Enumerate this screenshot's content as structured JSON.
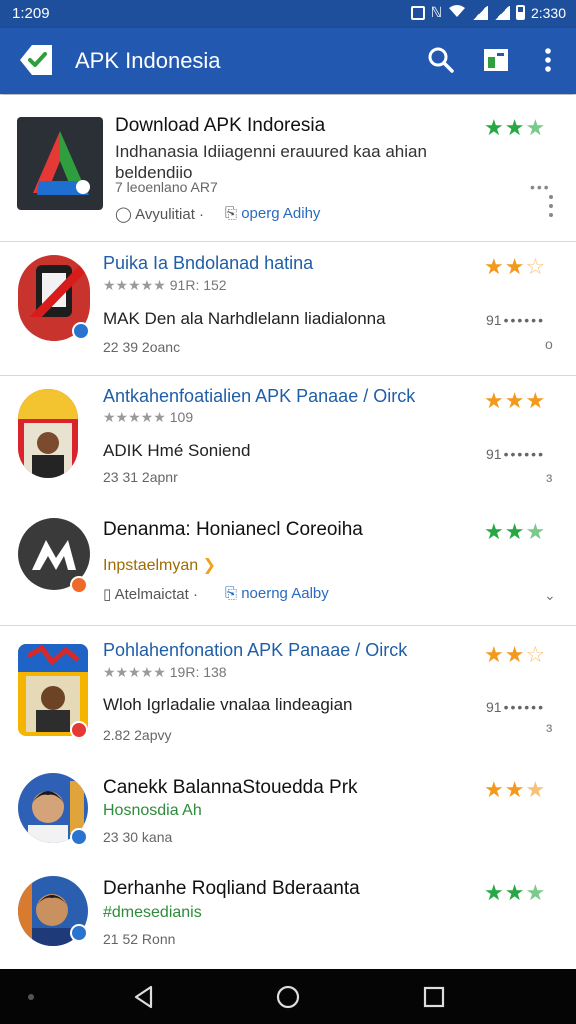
{
  "status_bar": {
    "time": "1:209",
    "right_text": "2:330",
    "icons": [
      "gallery-icon",
      "nfc-icon",
      "wifi-icon",
      "signal-icon",
      "signal-icon",
      "battery-icon"
    ]
  },
  "app_bar": {
    "title": "APK Indonesia",
    "actions": [
      "search-icon",
      "bookmark-icon",
      "more-vert-icon"
    ]
  },
  "colors": {
    "appbar": "#2258b0",
    "statusbar": "#1d4f9c",
    "star_green": "#27a844",
    "star_orange": "#f39a1e",
    "link_blue": "#1f5ea8"
  },
  "items": [
    {
      "title": "Download APK Indoresia",
      "desc1": "Indhanasia Idiiagenni erauured kaa ahian",
      "desc2": "beldendiio",
      "meta": "7 leoenlano AR7",
      "action1": "Avyulitiat ·",
      "action2": "operg Adihy",
      "stars": 2.5
    },
    {
      "title": "Puika Ia Bndolanad hatina",
      "reviews": "91R: 152",
      "subtitle": "MAK Den ala Narhdlelann liadialonna",
      "meta": "22 39 2oanc",
      "count": "91",
      "stars": 2.5
    },
    {
      "title": "Antkahenfoatialien APK Panaae / Oirck",
      "reviews": "109",
      "subtitle": "ADIK Hmé Soniend",
      "meta": "23 31 2apnr",
      "count": "91",
      "stars": 3
    },
    {
      "title": "Denanma: Honianecl Coreoiha",
      "tag": "Inpstaelmyan",
      "action1": "Atelmaictat ·",
      "action2": "noerng Aalby",
      "stars": 2.5
    },
    {
      "title": "Pohlahenfonation APK Panaae / Oirck",
      "reviews": "19R: 138",
      "subtitle": "Wloh Igrladalie vnalaa lindeagian",
      "meta": "2.82 2apvy",
      "count": "91",
      "stars": 2.5
    },
    {
      "title": "Canekk BalannaStouedda Prk",
      "tag": "Hosnosdia Ah",
      "meta": "23 30 kana",
      "stars": 3
    },
    {
      "title": "Derhanhe Roqliand Bderaanta",
      "tag": "#dmesedianis",
      "meta": "21 52 Ronn",
      "stars": 2.5
    }
  ],
  "nav_bar": [
    "back-icon",
    "home-icon",
    "recents-icon"
  ]
}
